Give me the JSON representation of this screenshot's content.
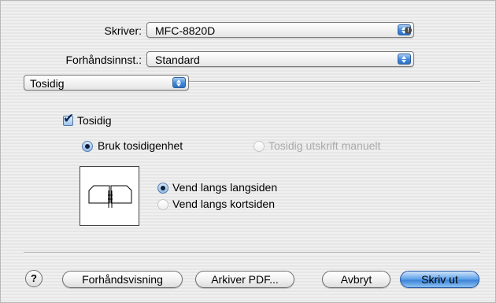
{
  "printer": {
    "label": "Skriver:",
    "value": "MFC-8820D"
  },
  "presets": {
    "label": "Forhåndsinnst.:",
    "value": "Standard"
  },
  "panel": {
    "value": "Tosidig"
  },
  "duplex": {
    "checkbox_label": "Tosidig",
    "checkmark": "✔",
    "use_unit": "Bruk tosidigenhet",
    "manual": "Tosidig utskrift manuelt",
    "long_edge": "Vend langs langsiden",
    "short_edge": "Vend langs kortsiden"
  },
  "footer": {
    "help": "?",
    "preview": "Forhåndsvisning",
    "save_pdf": "Arkiver PDF...",
    "cancel": "Avbryt",
    "print": "Skriv ut"
  },
  "colors": {
    "accent": "#3b84d8"
  }
}
